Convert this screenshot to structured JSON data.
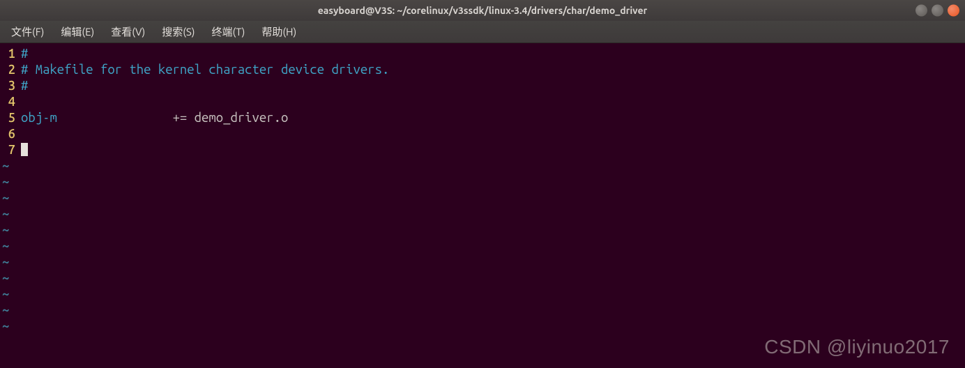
{
  "titlebar": {
    "title": "easyboard@V3S: ~/corelinux/v3ssdk/linux-3.4/drivers/char/demo_driver"
  },
  "menu": {
    "file": "文件(F)",
    "edit": "编辑(E)",
    "view": "查看(V)",
    "search": "搜索(S)",
    "terminal": "终端(T)",
    "help": "帮助(H)"
  },
  "lines": {
    "l1_no": "1",
    "l1_text": "#",
    "l2_no": "2",
    "l2_text": "# Makefile for the kernel character device drivers.",
    "l3_no": "3",
    "l3_text": "#",
    "l4_no": "4",
    "l4_text": "",
    "l5_no": "5",
    "l5_key": "obj-m",
    "l5_rest": "                += demo_driver.o",
    "l6_no": "6",
    "l6_text": "",
    "l7_no": "7"
  },
  "tilde": "~",
  "watermark": "CSDN @liyinuo2017"
}
